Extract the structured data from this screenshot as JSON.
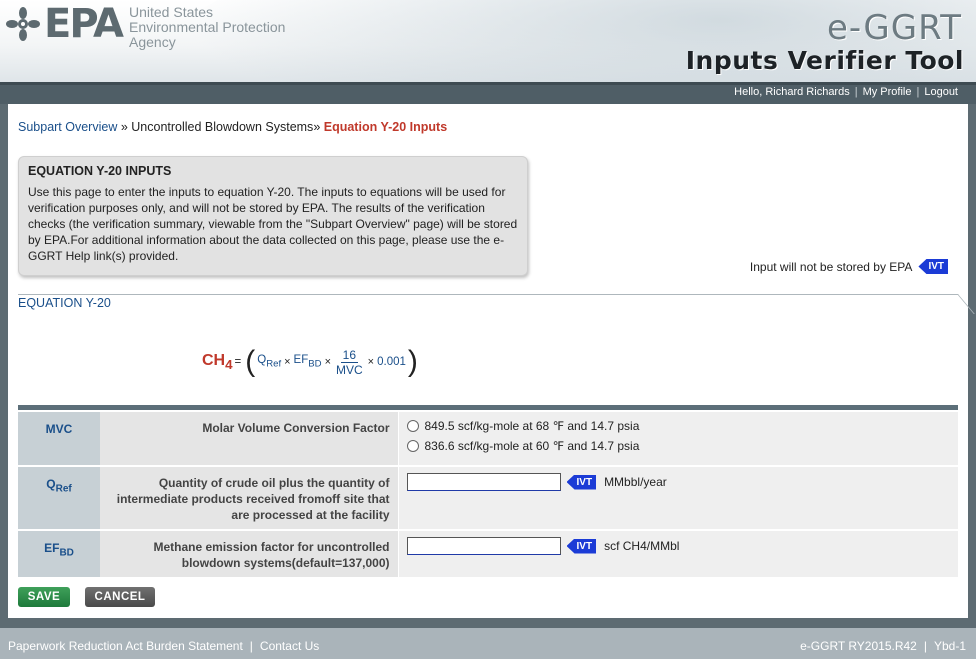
{
  "header": {
    "logo_text": "EPA",
    "agency_lines": [
      "United States",
      "Environmental Protection",
      "Agency"
    ],
    "app_name": "e-GGRT",
    "tool_name": "Inputs Verifier Tool"
  },
  "user_nav": {
    "greeting": "Hello, Richard Richards",
    "profile": "My Profile",
    "logout": "Logout",
    "separator": "|"
  },
  "breadcrumb": {
    "item1": "Subpart Overview",
    "sep1": "»",
    "item2": "Uncontrolled Blowdown Systems",
    "sep2": "»",
    "current": "Equation Y-20 Inputs"
  },
  "info": {
    "title": "EQUATION Y-20 INPUTS",
    "body": "Use this page to enter the inputs to equation Y-20. The inputs to equations will be used for verification purposes only, and will not be stored by EPA. The results of the verification checks (the verification summary, viewable from the \"Subpart Overview\" page) will be stored by EPA.For additional information about the data collected on this page, please use the e-GGRT Help link(s) provided."
  },
  "ivt_note": {
    "text": "Input will not be stored by EPA",
    "badge": "IVT"
  },
  "equation": {
    "legend": "EQUATION Y-20",
    "lhs": "CH",
    "lhs_sub": "4",
    "equals": "=",
    "open": "(",
    "close": ")",
    "q": "Q",
    "q_sub": "Ref",
    "times": "×",
    "ef": "EF",
    "ef_sub": "BD",
    "num": "16",
    "den": "MVC",
    "constant": "0.001"
  },
  "rows": [
    {
      "var": "MVC",
      "var_sub": "",
      "desc": "Molar Volume Conversion Factor",
      "options": [
        "849.5 scf/kg-mole at 68 ℉ and 14.7 psia",
        "836.6 scf/kg-mole at 60 ℉ and 14.7 psia"
      ]
    },
    {
      "var": "Q",
      "var_sub": "Ref",
      "desc": "Quantity of crude oil plus the quantity of intermediate products received fromoff site that are processed at the facility",
      "value": "",
      "badge": "IVT",
      "unit": "MMbbl/year"
    },
    {
      "var": "EF",
      "var_sub": "BD",
      "desc": "Methane emission factor for uncontrolled blowdown systems(default=137,000)",
      "value": "",
      "badge": "IVT",
      "unit": "scf CH4/MMbl"
    }
  ],
  "buttons": {
    "save": "SAVE",
    "cancel": "CANCEL"
  },
  "footer": {
    "paperwork": "Paperwork Reduction Act Burden Statement",
    "contact": "Contact Us",
    "version": "e-GGRT RY2015.R42",
    "page_id": "Ybd-1",
    "separator": "|"
  },
  "colors": {
    "accent_blue": "#1a4f8a",
    "current_red": "#c0392b",
    "ivt_blue": "#1b3bd6",
    "save_green": "#1e7a3b"
  }
}
